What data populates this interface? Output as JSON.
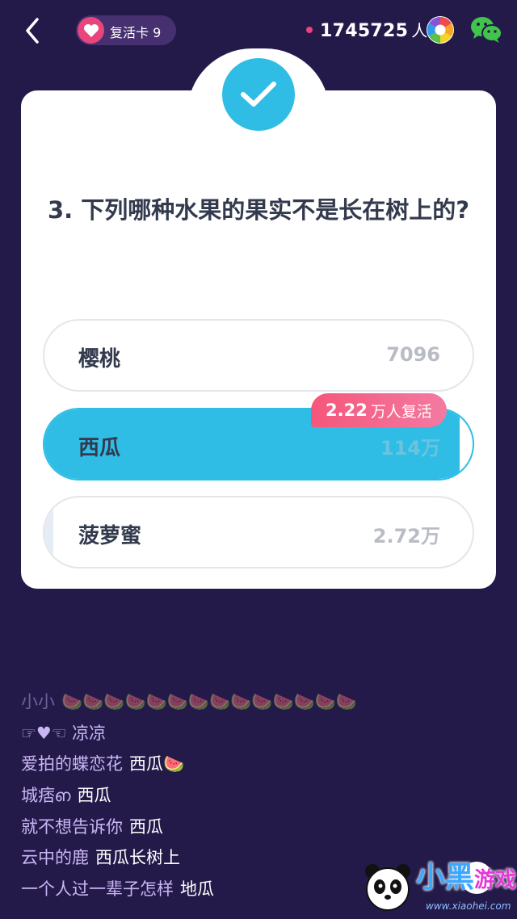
{
  "topbar": {
    "revive_label": "复活卡 9",
    "viewer_count": "1745725",
    "viewer_unit": "人",
    "icons": [
      "back-icon",
      "heart-icon",
      "shutter-icon",
      "wechat-icon"
    ]
  },
  "question": {
    "text": "3. 下列哪种水果的果实不是长在树上的?",
    "answered_correctly": true
  },
  "options": [
    {
      "label": "樱桃",
      "count": "7096",
      "fill_fraction": 0.0
    },
    {
      "label": "西瓜",
      "count": "114万",
      "fill_fraction": 0.97,
      "correct": true
    },
    {
      "label": "菠萝蜜",
      "count": "2.72万",
      "fill_fraction": 0.02
    }
  ],
  "revive_tag": {
    "number": "2.22",
    "text": "万人复活"
  },
  "comments": [
    {
      "user": "小小",
      "message": "🍉🍉🍉🍉🍉🍉🍉🍉🍉🍉🍉🍉🍉🍉"
    },
    {
      "user": "☞♥☜ 凉凉",
      "message": ""
    },
    {
      "user": "爱拍的蝶恋花",
      "message": "西瓜🍉"
    },
    {
      "user": "城痞ഩ",
      "message": "西瓜"
    },
    {
      "user": "就不想告诉你",
      "message": "西瓜"
    },
    {
      "user": "云中的鹿",
      "message": "西瓜长树上"
    },
    {
      "user": "一个人过一辈子怎样",
      "message": "地瓜"
    }
  ],
  "watermark": {
    "brand": "小黑",
    "brand_suffix": "游戏",
    "url": "www.xiaohei.com"
  },
  "colors": {
    "background": "#241a4a",
    "accent_blue": "#2fbde6",
    "accent_pink": "#e8457c",
    "card": "#ffffff"
  }
}
